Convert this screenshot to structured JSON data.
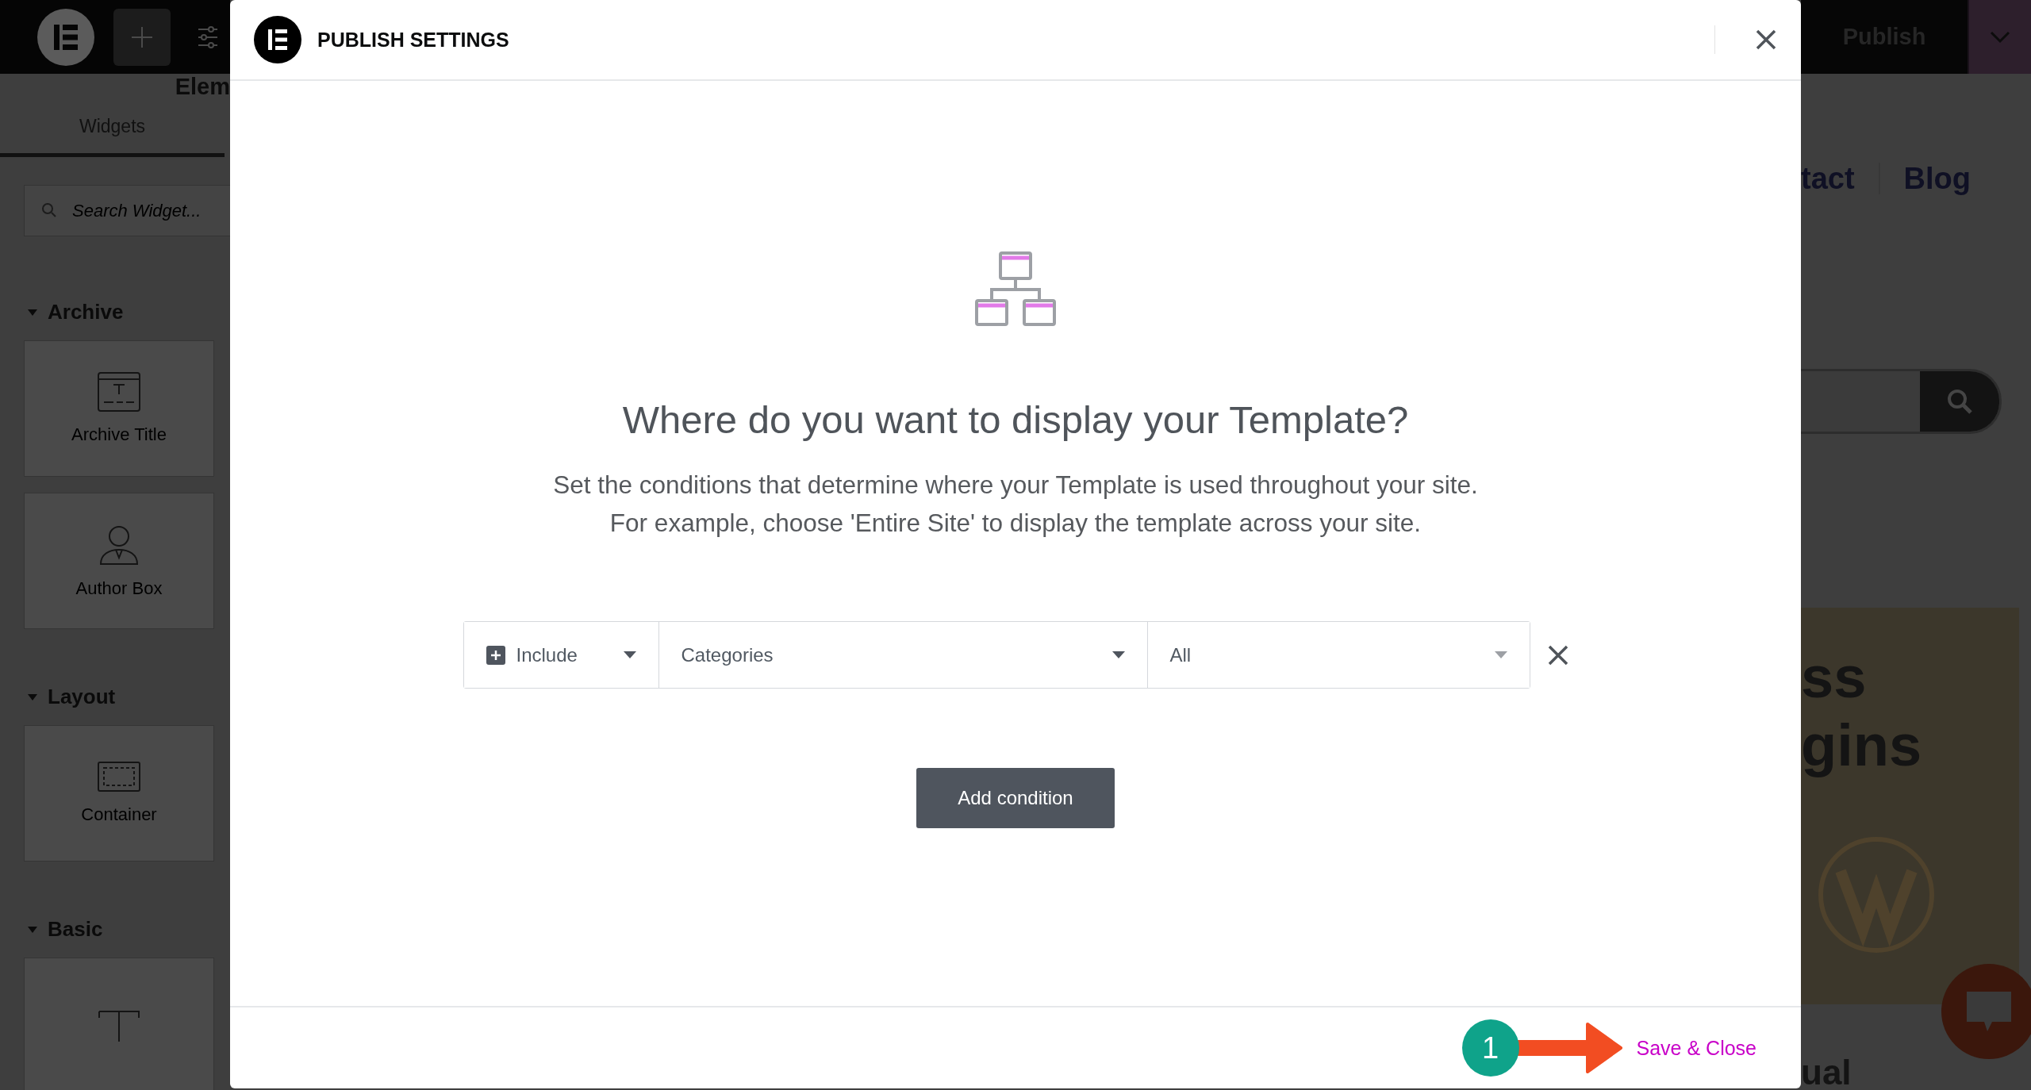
{
  "top_bar": {
    "publish_button": "Publish"
  },
  "sidebar": {
    "title": "Elem",
    "tabs": [
      {
        "label": "Widgets",
        "selected": true
      }
    ],
    "search": {
      "placeholder": "Search Widget..."
    },
    "sections": [
      {
        "title": "Archive",
        "expanded": true,
        "widgets": [
          {
            "label": "Archive Title",
            "kind": "title"
          },
          {
            "label": "Author Box",
            "kind": "author"
          }
        ]
      },
      {
        "title": "Layout",
        "expanded": true,
        "widgets": [
          {
            "label": "Container",
            "kind": "container"
          }
        ]
      },
      {
        "title": "Basic",
        "expanded": true,
        "widgets": [
          {
            "kind": "heading"
          }
        ]
      }
    ]
  },
  "preview": {
    "nav": [
      "tact",
      "Blog"
    ],
    "hero_lines": [
      "ss",
      "gins"
    ],
    "footer_text": "ual"
  },
  "dialog": {
    "title": "PUBLISH SETTINGS",
    "heading": "Where do you want to display your Template?",
    "description": [
      "Set the conditions that determine where your Template is used throughout your site.",
      "For example, choose 'Entire Site' to display the template across your site."
    ],
    "conditions": [
      {
        "type": "Include",
        "subtype": "Categories",
        "target": "All"
      }
    ],
    "add_button": "Add condition",
    "save_button": "Save & Close"
  },
  "annotation": {
    "step": "1"
  }
}
